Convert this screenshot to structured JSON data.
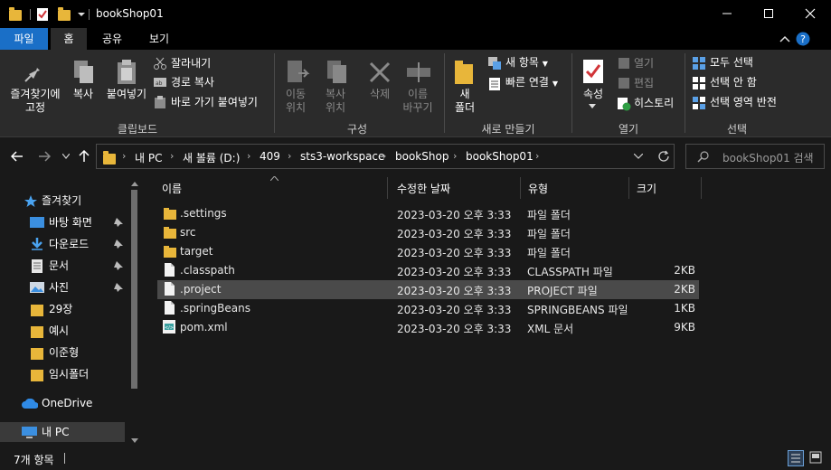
{
  "window": {
    "title": "bookShop01"
  },
  "ribbon_tabs": {
    "file": "파일",
    "home": "홈",
    "share": "공유",
    "view": "보기"
  },
  "ribbon": {
    "clipboard": {
      "pin_quick": "즐겨찾기에\n고정",
      "copy": "복사",
      "paste": "붙여넣기",
      "cut": "잘라내기",
      "copy_path": "경로 복사",
      "paste_shortcut": "바로 가기 붙여넣기",
      "label": "클립보드"
    },
    "organize": {
      "move_to": "이동\n위치",
      "copy_to": "복사\n위치",
      "delete": "삭제",
      "rename": "이름\n바꾸기",
      "label": "구성"
    },
    "new": {
      "new_folder": "새\n폴더",
      "new_item": "새 항목",
      "easy_access": "빠른 연결",
      "label": "새로 만들기"
    },
    "open": {
      "properties": "속성",
      "open": "열기",
      "edit": "편집",
      "history": "히스토리",
      "label": "열기"
    },
    "select": {
      "select_all": "모두 선택",
      "select_none": "선택 안 함",
      "invert": "선택 영역 반전",
      "label": "선택"
    }
  },
  "address": {
    "crumbs": [
      "내 PC",
      "새 볼륨 (D:)",
      "409",
      "sts3-workspace",
      "bookShop",
      "bookShop01"
    ],
    "search_placeholder": "bookShop01 검색"
  },
  "nav": {
    "items": [
      {
        "label": "즐겨찾기",
        "icon": "star-icon"
      },
      {
        "label": "바탕 화면",
        "icon": "desktop-icon",
        "pinned": true
      },
      {
        "label": "다운로드",
        "icon": "download-icon",
        "pinned": true
      },
      {
        "label": "문서",
        "icon": "document-icon",
        "pinned": true
      },
      {
        "label": "사진",
        "icon": "picture-icon",
        "pinned": true
      },
      {
        "label": "29장",
        "icon": "folder-icon"
      },
      {
        "label": "예시",
        "icon": "folder-icon"
      },
      {
        "label": "이준형",
        "icon": "folder-icon"
      },
      {
        "label": "임시폴더",
        "icon": "folder-icon"
      },
      {
        "label": "OneDrive",
        "icon": "cloud-icon"
      },
      {
        "label": "내 PC",
        "icon": "pc-icon"
      }
    ]
  },
  "columns": {
    "name": "이름",
    "modified": "수정한 날짜",
    "type": "유형",
    "size": "크기"
  },
  "files": [
    {
      "name": ".settings",
      "date": "2023-03-20 오후 3:33",
      "type": "파일 폴더",
      "size": "",
      "icon": "folder-icon"
    },
    {
      "name": "src",
      "date": "2023-03-20 오후 3:33",
      "type": "파일 폴더",
      "size": "",
      "icon": "folder-icon"
    },
    {
      "name": "target",
      "date": "2023-03-20 오후 3:33",
      "type": "파일 폴더",
      "size": "",
      "icon": "folder-icon"
    },
    {
      "name": ".classpath",
      "date": "2023-03-20 오후 3:33",
      "type": "CLASSPATH 파일",
      "size": "2KB",
      "icon": "file-icon"
    },
    {
      "name": ".project",
      "date": "2023-03-20 오후 3:33",
      "type": "PROJECT 파일",
      "size": "2KB",
      "icon": "file-icon"
    },
    {
      "name": ".springBeans",
      "date": "2023-03-20 오후 3:33",
      "type": "SPRINGBEANS 파일",
      "size": "1KB",
      "icon": "file-icon"
    },
    {
      "name": "pom.xml",
      "date": "2023-03-20 오후 3:33",
      "type": "XML 문서",
      "size": "9KB",
      "icon": "xml-file-icon"
    }
  ],
  "status": {
    "count": "7개 항목"
  },
  "colors": {
    "accent": "#1a6fc7",
    "folder": "#e8b63a",
    "background": "#191919",
    "ribbon": "#2b2b2b"
  }
}
